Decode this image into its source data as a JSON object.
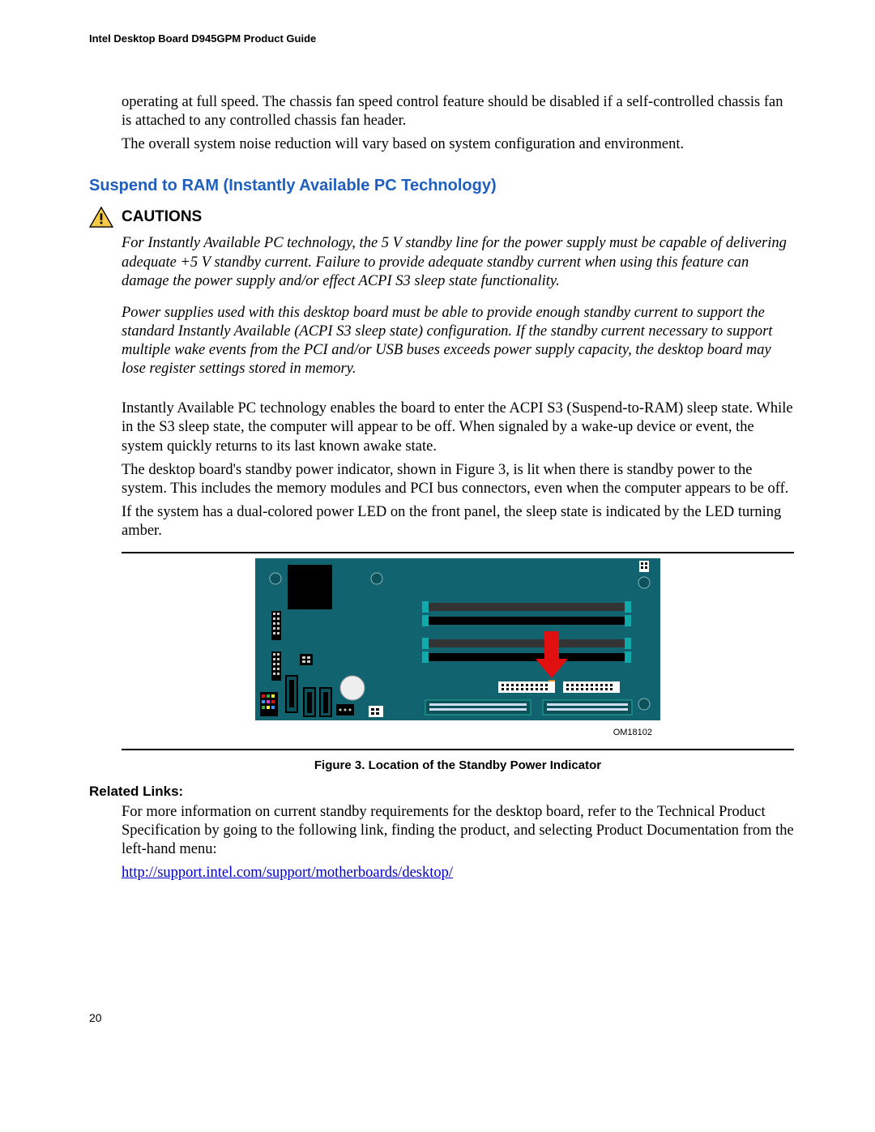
{
  "header": {
    "running_title": "Intel Desktop Board D945GPM Product Guide"
  },
  "intro": {
    "p1": "operating at full speed.  The chassis fan speed control feature should be disabled if a self-controlled chassis fan is attached to any controlled chassis fan header.",
    "p2": "The overall system noise reduction will vary based on system configuration and environment."
  },
  "section": {
    "heading": "Suspend to RAM (Instantly Available PC Technology)",
    "cautions_label": "CAUTIONS",
    "caution1": "For Instantly Available PC technology, the 5 V standby line for the power supply must be capable of delivering adequate +5 V standby current.  Failure to provide adequate standby current when using this feature can damage the power supply and/or effect ACPI S3 sleep state functionality.",
    "caution2": "Power supplies used with this desktop board must be able to provide enough standby current to support the standard Instantly Available (ACPI S3 sleep state) configuration.  If the standby current necessary to support multiple wake events from the PCI and/or USB buses exceeds power supply capacity, the desktop board may lose register settings stored in memory.",
    "body1": "Instantly Available PC technology enables the board to enter the ACPI S3 (Suspend-to-RAM) sleep state.  While in the S3 sleep state, the computer will appear to be off.  When signaled by a wake-up device or event, the system quickly returns to its last known awake state.",
    "body2": "The desktop board's standby power indicator, shown in Figure 3, is lit when there is standby power to the system.  This includes the memory modules and PCI bus connectors, even when the computer appears to be off.",
    "body3": "If the system has a dual-colored power LED on the front panel, the sleep state is indicated by the LED turning amber."
  },
  "figure": {
    "id": "OM18102",
    "caption": "Figure 3.  Location of the Standby Power Indicator"
  },
  "related": {
    "heading": "Related Links:",
    "text": "For more information on current standby requirements for the desktop board, refer to the Technical Product Specification by going to the following link, finding the product, and selecting Product Documentation from the left-hand menu:",
    "link_text": "http://support.intel.com/support/motherboards/desktop/",
    "link_href": "http://support.intel.com/support/motherboards/desktop/"
  },
  "page_number": "20"
}
